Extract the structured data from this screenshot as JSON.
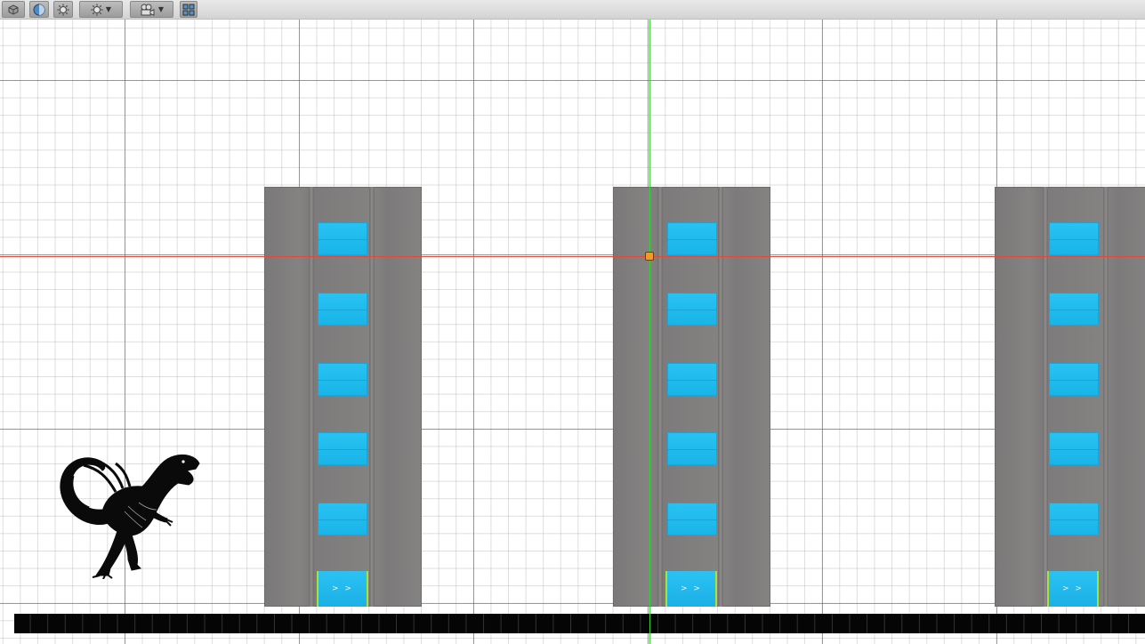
{
  "toolbar": {
    "buttons": [
      {
        "name": "draw-mode-button",
        "icon": "cube-icon"
      },
      {
        "name": "shading-button",
        "icon": "sphere-icon"
      },
      {
        "name": "lighting-button",
        "icon": "sun-icon"
      },
      {
        "name": "effects-dropdown",
        "icon": "sun-icon",
        "dropdown": true
      },
      {
        "name": "camera-dropdown",
        "icon": "camera-icon",
        "dropdown": true
      },
      {
        "name": "layout-button",
        "icon": "grid-icon"
      }
    ]
  },
  "scene": {
    "grid": true,
    "axis_colors": {
      "x": "#e04a3a",
      "y": "#37d037"
    },
    "building_color": "#828080",
    "window_color": "#1fbcee",
    "ground_color": "#050505",
    "buildings": [
      {
        "id": "building-1",
        "windows": 5,
        "door_label": "> >"
      },
      {
        "id": "building-2",
        "windows": 5,
        "door_label": "> >"
      },
      {
        "id": "building-3",
        "windows": 5,
        "door_label": "> >"
      }
    ],
    "player_sprite": "raptor-dinosaur-silhouette"
  }
}
